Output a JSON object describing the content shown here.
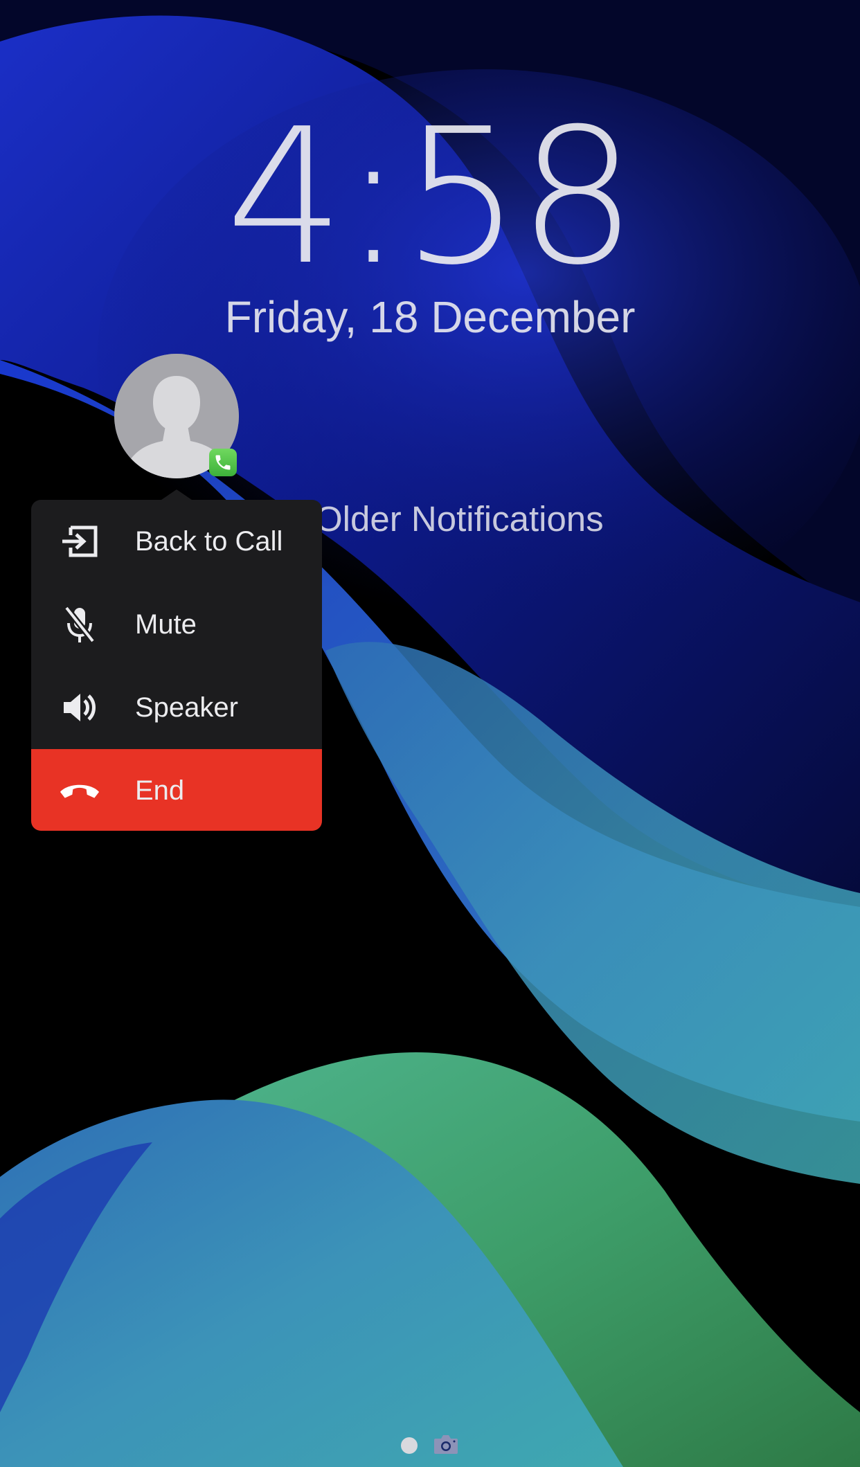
{
  "lock_screen": {
    "time": "4:58",
    "date": "Friday, 18 December",
    "older_notifications_label": "Older Notifications"
  },
  "call_menu": {
    "items": [
      {
        "label": "Back to Call",
        "icon": "back-to-call-icon"
      },
      {
        "label": "Mute",
        "icon": "mic-muted-icon"
      },
      {
        "label": "Speaker",
        "icon": "speaker-icon"
      },
      {
        "label": "End",
        "icon": "end-call-icon"
      }
    ]
  },
  "avatar": {
    "icon": "person-placeholder-icon",
    "badge_icon": "phone-badge-icon"
  },
  "page_indicator": {
    "icons": [
      "page-dot-icon",
      "camera-icon"
    ]
  },
  "colors": {
    "menu_background": "#1c1c1e",
    "end_button": "#e83325",
    "badge_green": "#4cc448",
    "avatar_gray": "#a6a6ab"
  }
}
